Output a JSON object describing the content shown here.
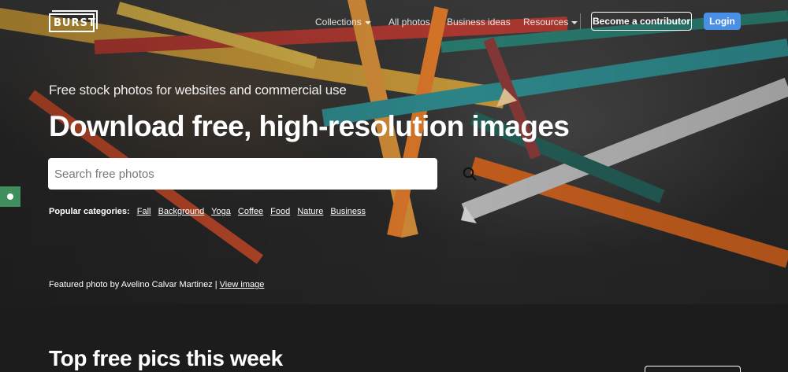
{
  "logo": {
    "text": "BURST"
  },
  "nav": {
    "links": [
      {
        "label": "Collections",
        "dropdown": true
      },
      {
        "label": "All photos",
        "dropdown": false
      },
      {
        "label": "Business ideas",
        "dropdown": false
      },
      {
        "label": "Resources",
        "dropdown": true
      }
    ],
    "contributor_label": "Become a contributor",
    "login_label": "Login"
  },
  "hero": {
    "tagline": "Free stock photos for websites and commercial use",
    "headline": "Download free, high-resolution images",
    "search": {
      "placeholder": "Search free photos",
      "value": "",
      "icon": "search-icon"
    },
    "categories_label": "Popular categories:",
    "categories": [
      "Fall",
      "Background",
      "Yoga",
      "Coffee",
      "Food",
      "Nature",
      "Business"
    ],
    "featured_prefix": "Featured photo by Avelino Calvar Martinez |",
    "featured_link": "View image"
  },
  "section": {
    "title": "Top free pics this week"
  },
  "colors": {
    "accent": "#4a8fe6",
    "side_tab": "#3e8e5e",
    "background": "#1c1c1c"
  }
}
